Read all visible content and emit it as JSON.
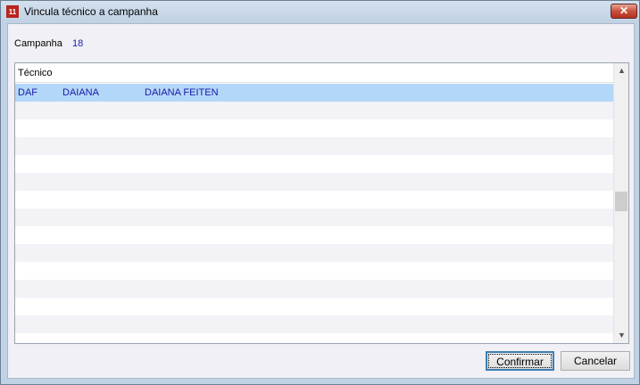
{
  "window": {
    "title": "Vincula técnico a campanha",
    "icon": "app-logo-icon",
    "close": "close-icon"
  },
  "campanha": {
    "label": "Campanha",
    "value": "18"
  },
  "grid": {
    "header": "Técnico",
    "rows": [
      {
        "code": "DAF",
        "name": "DAIANA",
        "full_name": "DAIANA FEITEN",
        "selected": true
      }
    ],
    "empty_rows": 13
  },
  "buttons": {
    "confirm": "Confirmar",
    "cancel": "Cancelar"
  },
  "colors": {
    "selected_row": "#b3d7f9",
    "alt_row": "#f2f2f7",
    "value_text": "#1a1aa6"
  }
}
